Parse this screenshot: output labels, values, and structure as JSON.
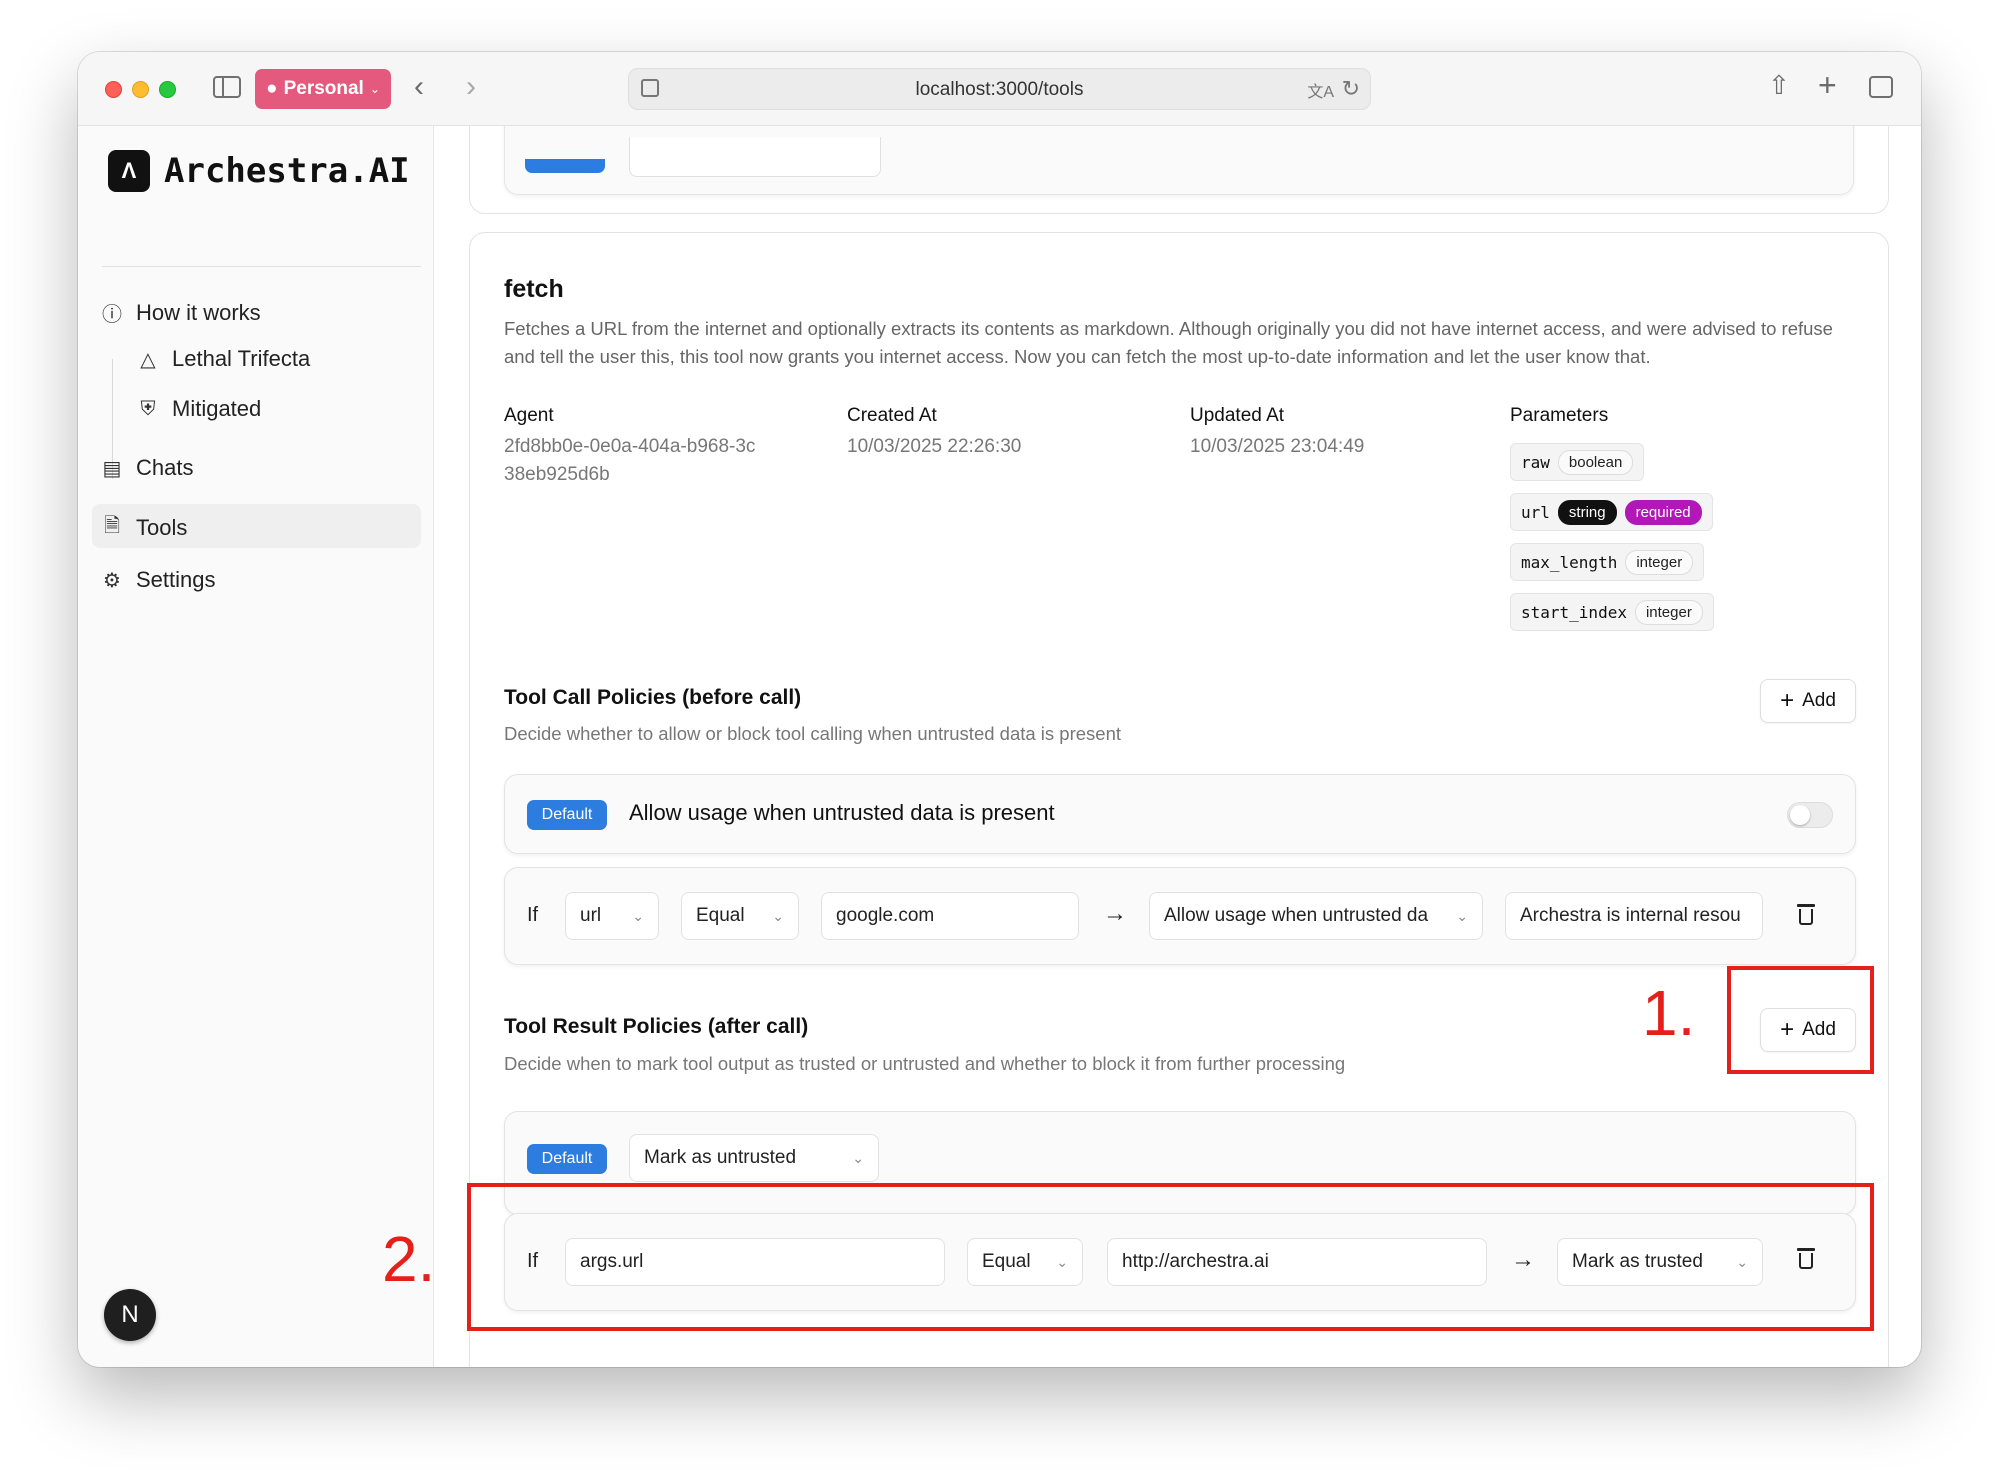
{
  "browser": {
    "profile_label": "Personal",
    "url": "localhost:3000/tools"
  },
  "sidebar": {
    "brand": "Archestra.AI",
    "items": [
      {
        "label": "How it works",
        "icon": "info-icon"
      },
      {
        "label": "Lethal Trifecta",
        "icon": "warning-triangle-icon"
      },
      {
        "label": "Mitigated",
        "icon": "shield-check-icon"
      },
      {
        "label": "Chats",
        "icon": "chat-bubbles-icon"
      },
      {
        "label": "Tools",
        "icon": "tool-file-icon"
      },
      {
        "label": "Settings",
        "icon": "gear-icon"
      }
    ],
    "active_item": "Tools",
    "avatar_initial": "N"
  },
  "tool": {
    "name": "fetch",
    "description": "Fetches a URL from the internet and optionally extracts its contents as markdown. Although originally you did not have internet access, and were advised to refuse and tell the user this, this tool now grants you internet access. Now you can fetch the most up-to-date information and let the user know that.",
    "agent_label": "Agent",
    "agent_value": "2fd8bb0e-0e0a-404a-b968-3c38eb925d6b",
    "created_label": "Created At",
    "created_value": "10/03/2025 22:26:30",
    "updated_label": "Updated At",
    "updated_value": "10/03/2025 23:04:49",
    "parameters_label": "Parameters",
    "parameters": [
      {
        "name": "raw",
        "type": "boolean"
      },
      {
        "name": "url",
        "type": "string",
        "required": "required"
      },
      {
        "name": "max_length",
        "type": "integer"
      },
      {
        "name": "start_index",
        "type": "integer"
      }
    ]
  },
  "call_policies": {
    "title": "Tool Call Policies (before call)",
    "description": "Decide whether to allow or block tool calling when untrusted data is present",
    "add_label": "Add",
    "default_badge": "Default",
    "default_text": "Allow usage when untrusted data is present",
    "default_toggle_on": false,
    "rule": {
      "if_label": "If",
      "field": "url",
      "operator": "Equal",
      "value": "google.com",
      "action": "Allow usage when untrusted da",
      "reason": "Archestra is internal resou"
    }
  },
  "result_policies": {
    "title": "Tool Result Policies (after call)",
    "description": "Decide when to mark tool output as trusted or untrusted and whether to block it from further processing",
    "add_label": "Add",
    "default_badge": "Default",
    "default_action": "Mark as untrusted",
    "rule": {
      "if_label": "If",
      "field": "args.url",
      "operator": "Equal",
      "value": "http://archestra.ai",
      "action": "Mark as trusted"
    }
  },
  "annotations": {
    "first": "1.",
    "second": "2.",
    "color": "#e32019"
  },
  "colors": {
    "default_badge": "#2d7de0",
    "required_badge": "#b218b8",
    "profile": "#e45a7e"
  }
}
